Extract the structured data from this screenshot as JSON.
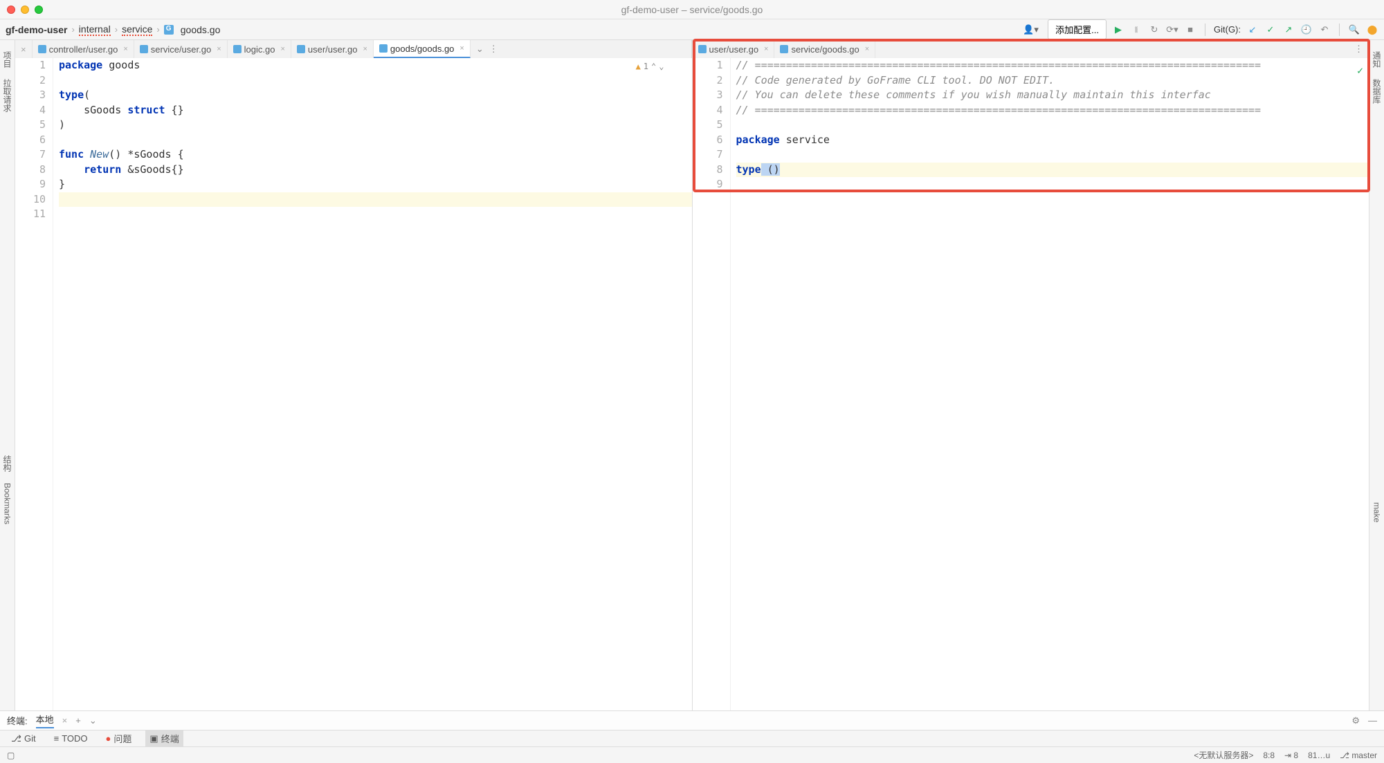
{
  "window": {
    "title": "gf-demo-user – service/goods.go"
  },
  "breadcrumb": {
    "root": "gf-demo-user",
    "parts": [
      "internal",
      "service",
      "goods.go"
    ]
  },
  "toolbar": {
    "config_btn": "添加配置...",
    "git_label": "Git(G):"
  },
  "tabs_left": [
    {
      "label": "controller/user.go"
    },
    {
      "label": "service/user.go"
    },
    {
      "label": "logic.go"
    },
    {
      "label": "user/user.go"
    },
    {
      "label": "goods/goods.go",
      "active": true
    }
  ],
  "tabs_right": [
    {
      "label": "user/user.go"
    },
    {
      "label": "service/goods.go"
    }
  ],
  "left_sidebar_tabs": [
    "项目",
    "拉取请求",
    "结构",
    "Bookmarks"
  ],
  "right_sidebar_tabs": [
    "通知",
    "数据库",
    "make"
  ],
  "editor_left": {
    "lines": [
      "1",
      "2",
      "3",
      "4",
      "5",
      "6",
      "7",
      "8",
      "9",
      "10",
      "11"
    ],
    "code": [
      {
        "t": "package",
        "c": "kw"
      },
      {
        "t": " goods\n\n"
      },
      {
        "t": "type",
        "c": "kw"
      },
      {
        "t": "(\n"
      },
      {
        "t": "    sGoods "
      },
      {
        "t": "struct",
        "c": "kw"
      },
      {
        "t": " {}\n"
      },
      {
        "t": ")\n\n"
      },
      {
        "t": "func ",
        "c": "kw"
      },
      {
        "t": "New",
        "c": "fn"
      },
      {
        "t": "() *sGoods {\n"
      },
      {
        "t": "    "
      },
      {
        "t": "return",
        "c": "kw"
      },
      {
        "t": " &sGoods{}\n"
      },
      {
        "t": "}"
      }
    ],
    "warn_count": "1"
  },
  "editor_right": {
    "lines": [
      "1",
      "2",
      "3",
      "4",
      "5",
      "6",
      "7",
      "8",
      "9"
    ],
    "comment1": "// =================================================================================",
    "comment2": "// Code generated by GoFrame CLI tool. DO NOT EDIT.",
    "comment3": "// You can delete these comments if you wish manually maintain this interfac",
    "comment4": "// =================================================================================",
    "pkg_kw": "package",
    "pkg_name": " service",
    "type_kw": "type",
    "type_parens": " ()"
  },
  "terminal": {
    "label": "终端:",
    "local": "本地"
  },
  "toolwindow": {
    "git": "Git",
    "todo": "TODO",
    "problems": "问题",
    "terminal": "终端"
  },
  "status": {
    "server": "<无默认服务器>",
    "pos": "8:8",
    "sp": "8",
    "enc": "81…u",
    "branch": "master"
  }
}
